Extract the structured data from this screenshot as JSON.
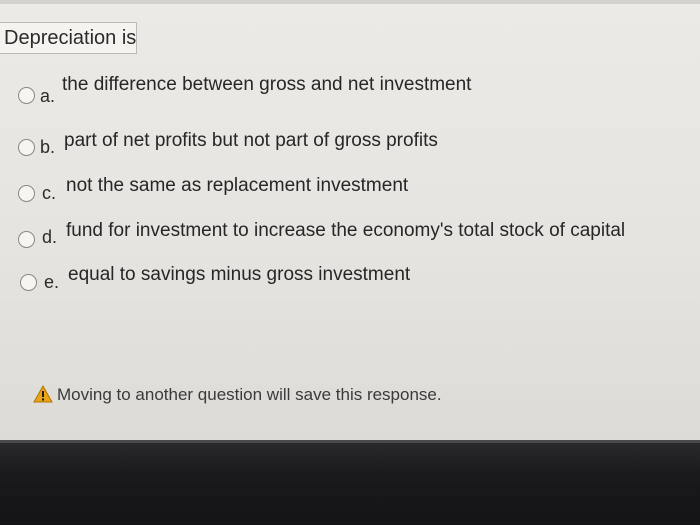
{
  "question": {
    "text": "Depreciation is"
  },
  "options": [
    {
      "letter": "a.",
      "text": "the difference between gross and net investment",
      "selected": false
    },
    {
      "letter": "b.",
      "text": "part of net profits but not part of gross profits",
      "selected": false
    },
    {
      "letter": "c.",
      "text": "not the same as replacement investment",
      "selected": false
    },
    {
      "letter": "d.",
      "text": "fund for investment to increase the economy's total stock of capital",
      "selected": false
    },
    {
      "letter": "e.",
      "text": "equal to savings minus gross investment",
      "selected": false
    }
  ],
  "warning": {
    "icon": "warning-triangle-icon",
    "text": "Moving to another question will save this response.",
    "icon_color": "#e8a317"
  }
}
